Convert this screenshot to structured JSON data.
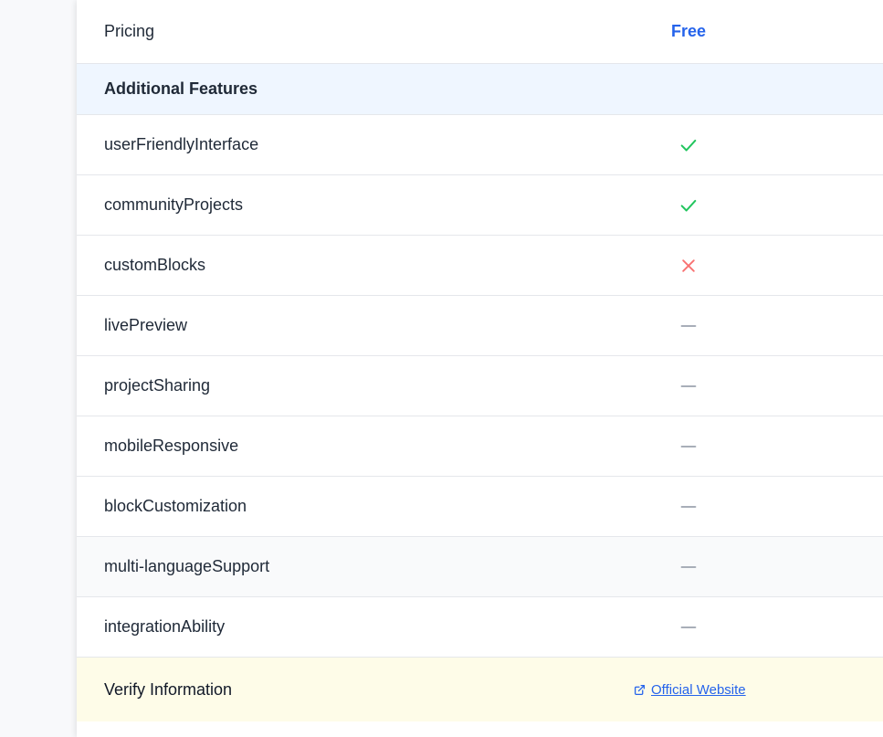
{
  "pricing": {
    "label": "Pricing",
    "value": "Free"
  },
  "section": {
    "title": "Additional Features"
  },
  "features": [
    {
      "label": "userFriendlyInterface",
      "status": "yes",
      "icon": "check-icon",
      "color": "#22c55e"
    },
    {
      "label": "communityProjects",
      "status": "yes",
      "icon": "check-icon",
      "color": "#22c55e"
    },
    {
      "label": "customBlocks",
      "status": "no",
      "icon": "cross-icon",
      "color": "#f87171"
    },
    {
      "label": "livePreview",
      "status": "unknown",
      "icon": "dash-icon",
      "color": "#9ca3af"
    },
    {
      "label": "projectSharing",
      "status": "unknown",
      "icon": "dash-icon",
      "color": "#9ca3af"
    },
    {
      "label": "mobileResponsive",
      "status": "unknown",
      "icon": "dash-icon",
      "color": "#9ca3af"
    },
    {
      "label": "blockCustomization",
      "status": "unknown",
      "icon": "dash-icon",
      "color": "#9ca3af"
    },
    {
      "label": "multi-languageSupport",
      "status": "unknown",
      "icon": "dash-icon",
      "color": "#9ca3af"
    },
    {
      "label": "integrationAbility",
      "status": "unknown",
      "icon": "dash-icon",
      "color": "#9ca3af"
    }
  ],
  "verify": {
    "label": "Verify Information",
    "link_text": "Official Website",
    "link_icon": "external-link-icon"
  },
  "colors": {
    "accent": "#2563eb",
    "section_bg": "#eff6ff",
    "verify_bg": "#fefce8"
  }
}
